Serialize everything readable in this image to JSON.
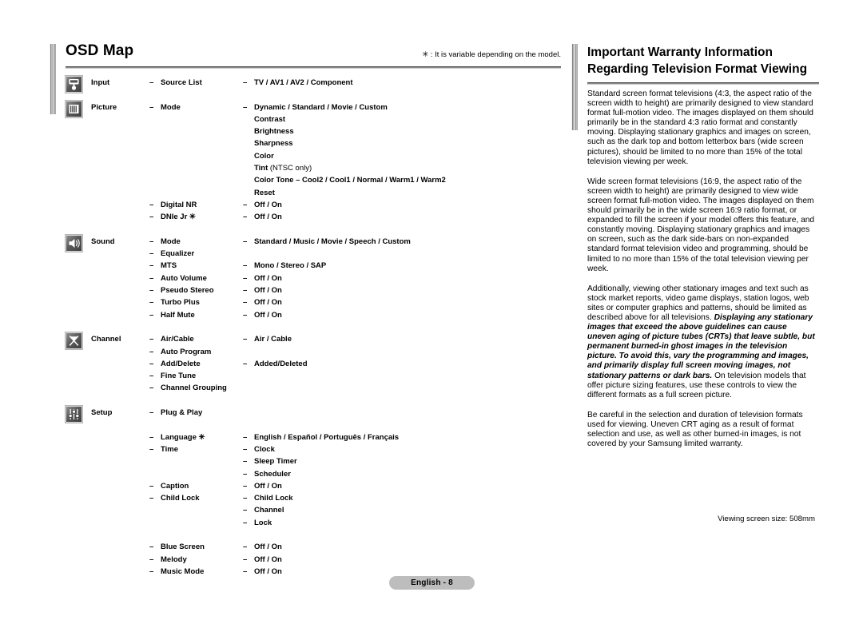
{
  "left": {
    "title": "OSD Map",
    "variable_note": "✳ : It is variable depending on the model.",
    "sections": [
      {
        "icon": "input-icon",
        "category": "Input",
        "rows": [
          {
            "l1": "Source List",
            "l2": "TV / AV1 / AV2 / Component"
          }
        ]
      },
      {
        "icon": "picture-icon",
        "category": "Picture",
        "rows": [
          {
            "l1": "Mode",
            "l2": "Dynamic / Standard / Movie / Custom"
          },
          {
            "l1": "",
            "l2": "Contrast",
            "indent": true
          },
          {
            "l1": "",
            "l2": "Brightness",
            "indent": true
          },
          {
            "l1": "",
            "l2": "Sharpness",
            "indent": true
          },
          {
            "l1": "",
            "l2": "Color",
            "indent": true
          },
          {
            "l1": "",
            "l2": "Tint",
            "l2_light": " (NTSC only)",
            "indent": true
          },
          {
            "l1": "",
            "l2": "Color Tone – Cool2 / Cool1 / Normal / Warm1 / Warm2",
            "indent": true
          },
          {
            "l1": "",
            "l2": "Reset",
            "indent": true
          },
          {
            "l1": "Digital NR",
            "l2": "Off / On"
          },
          {
            "l1": "DNIe Jr ✳",
            "l2": "Off / On"
          }
        ]
      },
      {
        "icon": "sound-icon",
        "category": "Sound",
        "rows": [
          {
            "l1": "Mode",
            "l2": "Standard / Music / Movie / Speech / Custom"
          },
          {
            "l1": "Equalizer",
            "l2": ""
          },
          {
            "l1": "MTS",
            "l2": "Mono / Stereo / SAP"
          },
          {
            "l1": "Auto Volume",
            "l2": "Off / On"
          },
          {
            "l1": "Pseudo Stereo",
            "l2": "Off / On"
          },
          {
            "l1": "Turbo Plus",
            "l2": "Off / On"
          },
          {
            "l1": "Half Mute",
            "l2": "Off / On"
          }
        ]
      },
      {
        "icon": "channel-icon",
        "category": "Channel",
        "rows": [
          {
            "l1": "Air/Cable",
            "l2": "Air / Cable"
          },
          {
            "l1": "Auto Program",
            "l2": ""
          },
          {
            "l1": "Add/Delete",
            "l2": "Added/Deleted"
          },
          {
            "l1": "Fine Tune",
            "l2": ""
          },
          {
            "l1": "Channel  Grouping",
            "l2": ""
          }
        ]
      },
      {
        "icon": "setup-icon",
        "category": "Setup",
        "rows": [
          {
            "l1": "Plug & Play",
            "l2": ""
          },
          {
            "l1": "",
            "l2": ""
          },
          {
            "l1": "Language ✳",
            "l2": "English / Español / Português / Français"
          },
          {
            "l1": "Time",
            "l2": "Clock"
          },
          {
            "l1": "",
            "l2": "Sleep Timer"
          },
          {
            "l1": "",
            "l2": "Scheduler"
          },
          {
            "l1": "Caption",
            "l2": "Off / On"
          },
          {
            "l1": "Child Lock",
            "l2": "Child Lock"
          },
          {
            "l1": "",
            "l2": "Channel"
          },
          {
            "l1": "",
            "l2": "Lock"
          },
          {
            "l1": "",
            "l2": ""
          },
          {
            "l1": "Blue Screen",
            "l2": "Off / On"
          },
          {
            "l1": "Melody",
            "l2": "Off / On"
          },
          {
            "l1": "Music Mode",
            "l2": "Off / On"
          }
        ]
      }
    ]
  },
  "right": {
    "title_line1": "Important Warranty Information",
    "title_line2": "Regarding Television Format Viewing",
    "paragraphs": [
      {
        "text": "Standard screen format televisions (4:3, the aspect ratio of the screen width to height) are primarily designed to view standard format full-motion video. The images displayed on them should primarily be in the standard 4:3 ratio format and constantly moving. Displaying stationary graphics and images on screen, such as the dark top and bottom letterbox bars (wide screen pictures), should be limited to no more than 15% of the total television viewing per week."
      },
      {
        "text": "Wide screen format televisions (16:9, the aspect ratio of the screen width to height) are primarily designed to view wide screen format full-motion video. The images displayed on them should primarily be in the wide screen 16:9 ratio format, or expanded to fill the screen if your model offers this feature, and constantly moving. Displaying stationary graphics and images on screen, such as the dark side-bars on non-expanded standard format television video and programming, should be limited to no more than 15% of the total television viewing per week."
      },
      {
        "lead": "Additionally, viewing other stationary images and text such as stock market reports, video game displays, station logos, web sites or computer graphics and patterns, should be limited as described above for all televisions. ",
        "emphasis": "Displaying any stationary images that exceed the above guidelines can cause uneven aging of picture tubes (CRTs) that leave subtle, but permanent burned-in ghost images in the television picture. To avoid this, vary the programming and images, and primarily display full screen moving images, not stationary patterns or dark bars.",
        "tail": " On television models that offer picture sizing features, use these controls to view the different formats as a full screen picture."
      },
      {
        "text": "Be careful in the selection and duration of television formats used for viewing. Uneven CRT aging as a result of format selection and use, as well as other burned-in images, is not covered by your Samsung limited warranty."
      }
    ],
    "screen_size": "Viewing screen size: 508mm"
  },
  "footer": {
    "page_label": "English - 8"
  }
}
